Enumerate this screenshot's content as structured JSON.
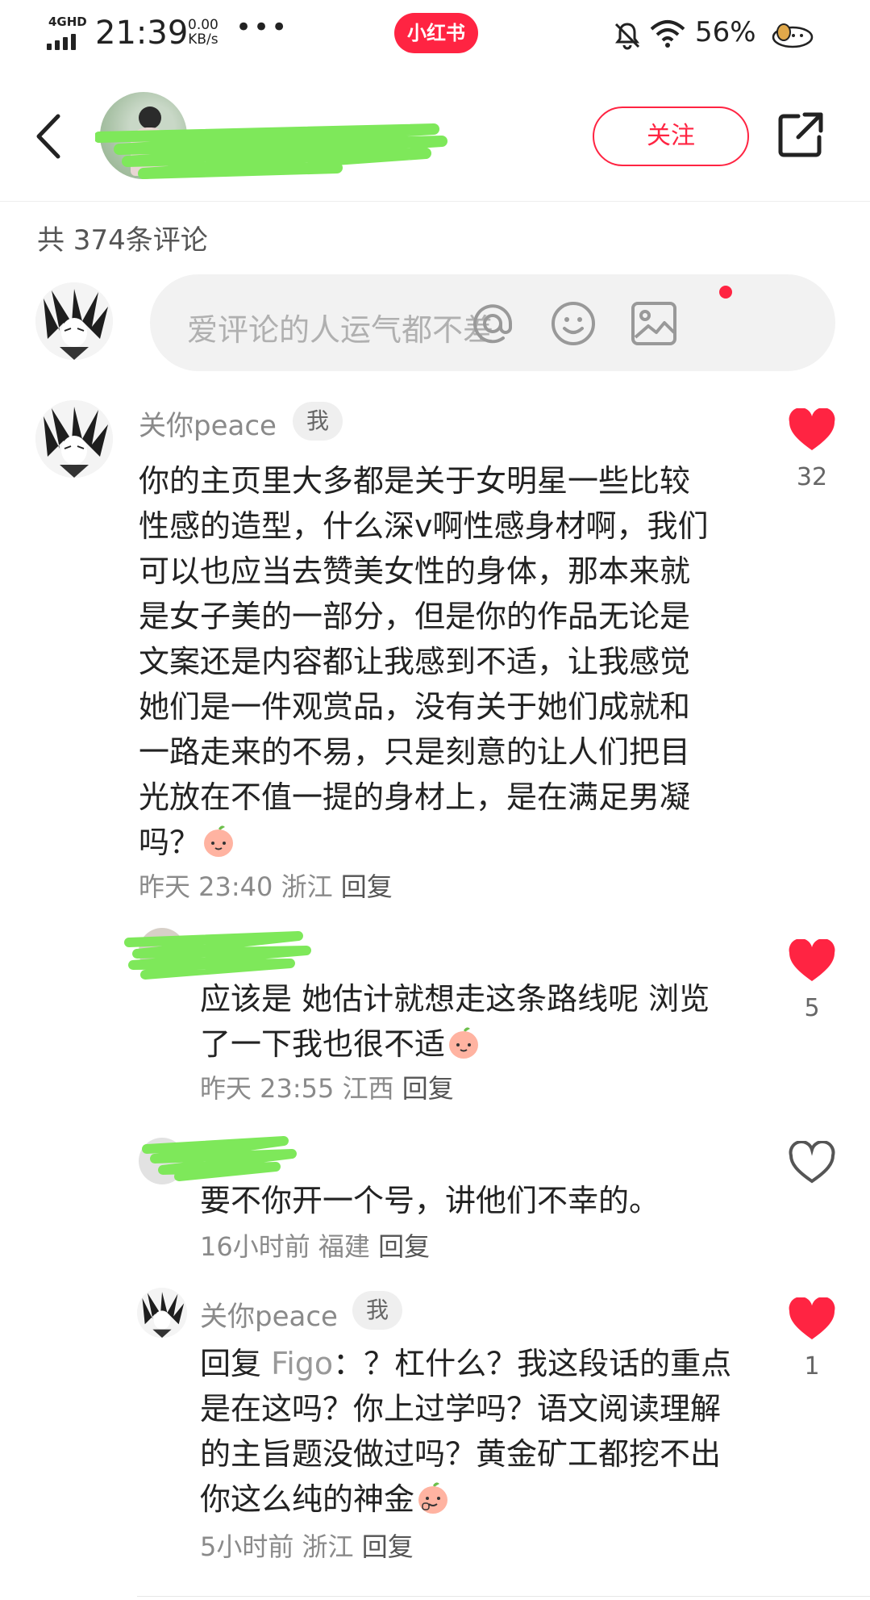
{
  "status_bar": {
    "network": "4GHD",
    "time": "21:39",
    "speed_value": "0.00",
    "speed_unit": "KB/s",
    "more": "•••",
    "app_badge": "小红书",
    "battery": "56%",
    "icons": [
      "signal-icon",
      "bell-muted-icon",
      "wifi-icon",
      "dog-icon"
    ]
  },
  "header": {
    "back_icon": "chevron-left-icon",
    "author_name": "",
    "follow_label": "关注",
    "share_icon": "share-icon",
    "accent_color": "#ff2442"
  },
  "comments_section": {
    "total_label": "共 374条评论"
  },
  "input": {
    "placeholder": "爱评论的人运气都不差",
    "icons": [
      "at-icon",
      "emoji-icon",
      "image-icon"
    ]
  },
  "comments": [
    {
      "author": "关你peace",
      "badge": "我",
      "text": "你的主页里大多都是关于女明星一些比较性感的造型，什么深v啊性感身材啊，我们可以也应当去赞美女性的身体，那本来就是女子美的一部分，但是你的作品无论是文案还是内容都让我感到不适，让我感觉她们是一件观赏品，没有关于她们成就和一路走来的不易，只是刻意的让人们把目光放在不值一提的身材上，是在满足男凝吗？",
      "time": "昨天 23:40",
      "location": "浙江",
      "reply_label": "回复",
      "likes": "32",
      "liked": true
    },
    {
      "author": "",
      "text": "应该是 她估计就想走这条路线呢 浏览了一下我也很不适",
      "time": "昨天 23:55",
      "location": "江西",
      "reply_label": "回复",
      "likes": "5",
      "liked": true
    },
    {
      "author": "",
      "text": "要不你开一个号，讲他们不幸的。",
      "time": "16小时前",
      "location": "福建",
      "reply_label": "回复",
      "likes": "",
      "liked": false
    },
    {
      "author": "关你peace",
      "badge": "我",
      "reply_prefix": "回复",
      "reply_target": "Figo",
      "text": "：？杠什么？我这段话的重点是在这吗？你上过学吗？语文阅读理解的主旨题没做过吗？黄金矿工都挖不出你这么纯的神金",
      "time": "5小时前",
      "location": "浙江",
      "reply_label": "回复",
      "likes": "1",
      "liked": true
    }
  ]
}
